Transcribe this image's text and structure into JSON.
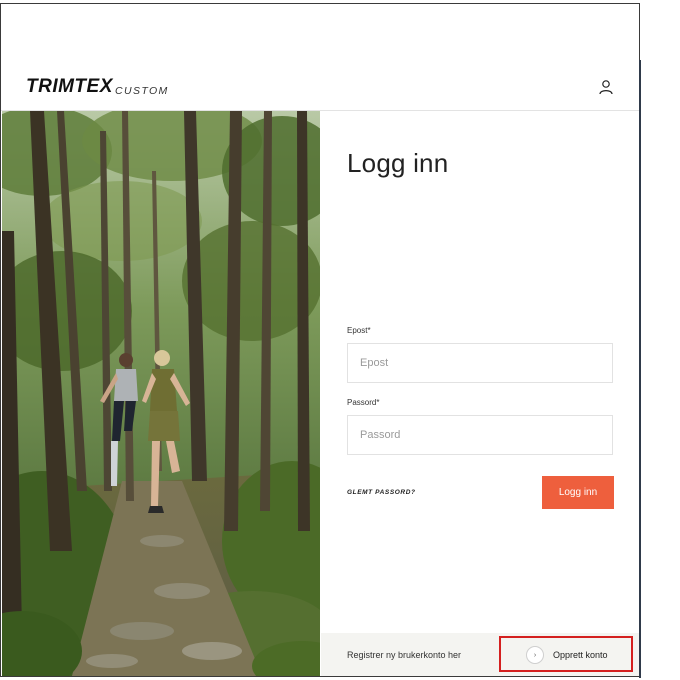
{
  "brand": {
    "name": "TRIMTEX",
    "sub": "CUSTOM"
  },
  "header": {
    "icon": "user-icon"
  },
  "login": {
    "title": "Logg inn",
    "email_label": "Epost*",
    "email_placeholder": "Epost",
    "email_value": "",
    "password_label": "Passord*",
    "password_placeholder": "Passord",
    "password_value": "",
    "forgot_label": "GLEMT PASSORD?",
    "submit_label": "Logg inn"
  },
  "register": {
    "text": "Registrer ny brukerkonto her",
    "button_label": "Opprett konto",
    "button_icon": "chevron-right-icon",
    "button_glyph": "›"
  },
  "colors": {
    "accent": "#ee5f3d",
    "highlight": "#d42020",
    "footer_bg": "#f4f4f1"
  }
}
